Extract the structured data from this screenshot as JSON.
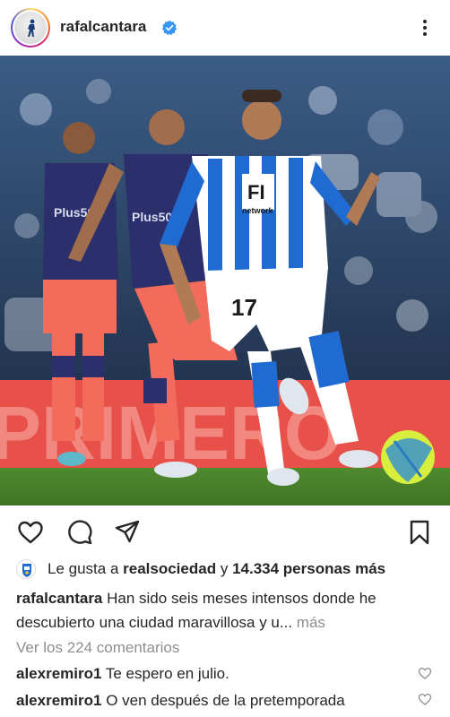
{
  "header": {
    "username": "rafalcantara",
    "verified": true
  },
  "post": {
    "image_description_icon": "football-photo",
    "shirt_number": "17",
    "shirt_sponsor": "network",
    "opponent_sponsor": "Plus500",
    "board_text": "PRIMERO"
  },
  "likes": {
    "prefix": "Le gusta a",
    "liker": "realsociedad",
    "connector": "y",
    "count_text": "14.334 personas más"
  },
  "caption": {
    "username": "rafalcantara",
    "text": "Han sido seis meses intensos donde he descubierto una ciudad maravillosa y u...",
    "more_label": "más"
  },
  "view_comments_label": "Ver los 224 comentarios",
  "comments": [
    {
      "username": "alexremiro1",
      "text": "Te espero en julio."
    },
    {
      "username": "alexremiro1",
      "text": "O ven después de la pretemporada"
    }
  ],
  "colors": {
    "verified": "#3897f0",
    "text": "#262626",
    "muted": "#8e8e8e",
    "real_sociedad_blue": "#1f6bd1",
    "atletico_navy": "#2b2f6b",
    "atletico_coral": "#f26b5b"
  }
}
